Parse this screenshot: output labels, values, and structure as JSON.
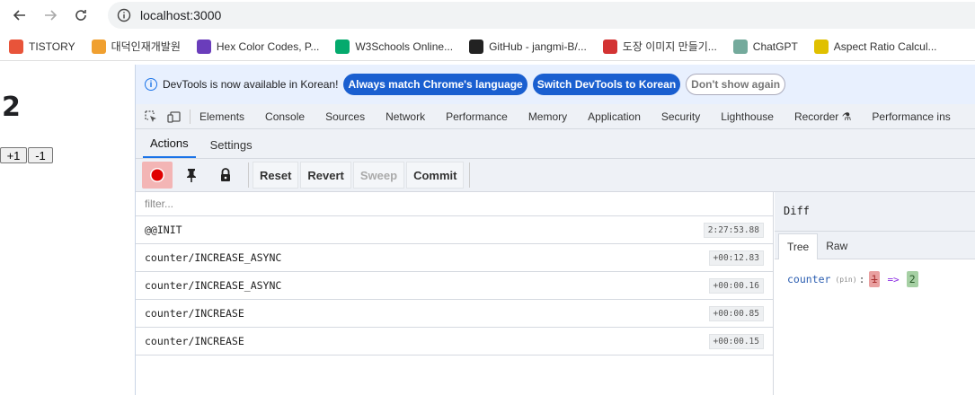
{
  "browser": {
    "url": "localhost:3000",
    "bookmarks": [
      {
        "label": "TISTORY",
        "icon": "tistory-icon",
        "color": "#e8543a"
      },
      {
        "label": "대덕인재개발원",
        "icon": "ddit-icon",
        "color": "#f0a030"
      },
      {
        "label": "Hex Color Codes, P...",
        "icon": "hex-color-icon",
        "color": "#6a3dbb"
      },
      {
        "label": "W3Schools Online...",
        "icon": "w3schools-icon",
        "color": "#04aa6d"
      },
      {
        "label": "GitHub - jangmi-B/...",
        "icon": "github-icon",
        "color": "#222222"
      },
      {
        "label": "도장 이미지 만들기...",
        "icon": "stamp-icon",
        "color": "#d33333"
      },
      {
        "label": "ChatGPT",
        "icon": "chatgpt-icon",
        "color": "#74aa9c"
      },
      {
        "label": "Aspect Ratio Calcul...",
        "icon": "aspect-ratio-icon",
        "color": "#e0c000"
      }
    ]
  },
  "page": {
    "count": "2",
    "inc_label": "+1",
    "dec_label": "-1"
  },
  "devtools": {
    "info": {
      "message": "DevTools is now available in Korean!",
      "match_btn": "Always match Chrome's language",
      "switch_btn": "Switch DevTools to Korean",
      "dismiss_btn": "Don't show again"
    },
    "tabs": [
      "Elements",
      "Console",
      "Sources",
      "Network",
      "Performance",
      "Memory",
      "Application",
      "Security",
      "Lighthouse",
      "Recorder ⚗",
      "Performance ins"
    ],
    "subtabs": [
      "Actions",
      "Settings"
    ],
    "toolbar": {
      "reset": "Reset",
      "revert": "Revert",
      "sweep": "Sweep",
      "commit": "Commit"
    },
    "filter_placeholder": "filter...",
    "actions": [
      {
        "name": "@@INIT",
        "time": "2:27:53.88"
      },
      {
        "name": "counter/INCREASE_ASYNC",
        "time": "+00:12.83"
      },
      {
        "name": "counter/INCREASE_ASYNC",
        "time": "+00:00.16"
      },
      {
        "name": "counter/INCREASE",
        "time": "+00:00.85"
      },
      {
        "name": "counter/INCREASE",
        "time": "+00:00.15"
      }
    ],
    "diff": {
      "title": "Diff",
      "tabs": [
        "Tree",
        "Raw"
      ],
      "key": "counter",
      "pin": "(pin)",
      "colon": ":",
      "old": "1",
      "arrow": "=>",
      "new": "2"
    }
  }
}
